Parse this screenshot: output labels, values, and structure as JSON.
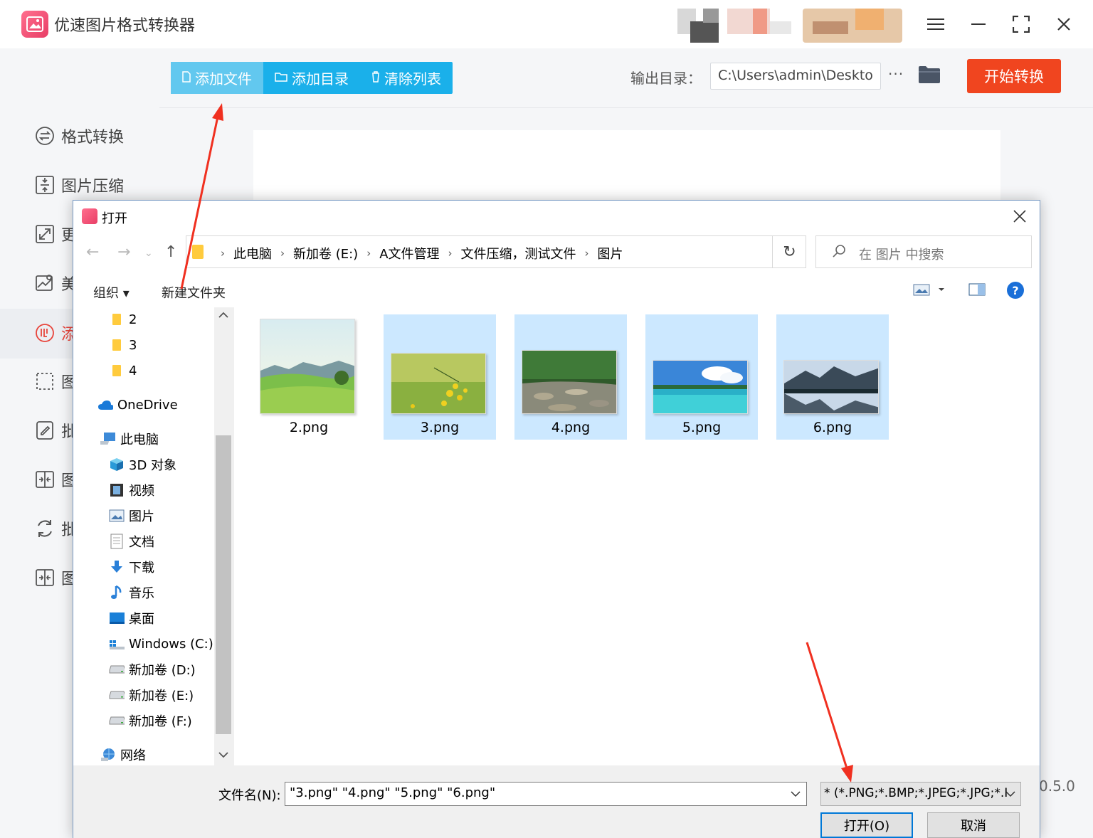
{
  "app": {
    "title": "优速图片格式转换器",
    "accent": "#1ab0ea",
    "start_color": "#f0451f"
  },
  "window_controls": {
    "menu": "menu-icon",
    "minimize": "minimize-icon",
    "maximize": "maximize-icon",
    "close": "close-icon"
  },
  "sidebar": {
    "items": [
      {
        "label": "格式转换",
        "icon": "swap-icon"
      },
      {
        "label": "图片压缩",
        "icon": "compress-icon"
      },
      {
        "label": "更",
        "icon": "resize-icon"
      },
      {
        "label": "美",
        "icon": "beautify-icon"
      },
      {
        "label": "添",
        "icon": "watermark-icon",
        "active": true
      },
      {
        "label": "图",
        "icon": "crop-icon"
      },
      {
        "label": "批",
        "icon": "edit-icon"
      },
      {
        "label": "图",
        "icon": "merge-icon"
      },
      {
        "label": "批",
        "icon": "rotate-icon"
      },
      {
        "label": "图",
        "icon": "split-icon"
      }
    ]
  },
  "toolbar": {
    "add_file": "添加文件",
    "add_dir": "添加目录",
    "clear_list": "清除列表",
    "output_label": "输出目录：",
    "output_path": "C:\\Users\\admin\\Deskto",
    "more": "···",
    "start": "开始转换"
  },
  "version": "0.5.0",
  "dialog": {
    "title": "打开",
    "breadcrumb": [
      "此电脑",
      "新加卷 (E:)",
      "A文件管理",
      "文件压缩，测试文件",
      "图片"
    ],
    "search_placeholder": "在 图片 中搜索",
    "organize": "组织 ▾",
    "new_folder": "新建文件夹",
    "help": "?",
    "nav": [
      {
        "label": "2",
        "icon": "folder-icon"
      },
      {
        "label": "3",
        "icon": "folder-icon"
      },
      {
        "label": "4",
        "icon": "folder-icon"
      },
      {
        "label": "OneDrive",
        "icon": "cloud-icon"
      },
      {
        "label": "此电脑",
        "icon": "computer-icon"
      },
      {
        "label": "3D 对象",
        "icon": "cube-icon"
      },
      {
        "label": "视频",
        "icon": "video-icon"
      },
      {
        "label": "图片",
        "icon": "pictures-icon"
      },
      {
        "label": "文档",
        "icon": "document-icon"
      },
      {
        "label": "下载",
        "icon": "download-icon"
      },
      {
        "label": "音乐",
        "icon": "music-icon"
      },
      {
        "label": "桌面",
        "icon": "desktop-icon"
      },
      {
        "label": "Windows (C:)",
        "icon": "drive-icon"
      },
      {
        "label": "新加卷 (D:)",
        "icon": "drive-icon"
      },
      {
        "label": "新加卷 (E:)",
        "icon": "drive-icon",
        "selected": true
      },
      {
        "label": "新加卷 (F:)",
        "icon": "drive-icon"
      },
      {
        "label": "网络",
        "icon": "network-icon"
      }
    ],
    "files": [
      {
        "name": "2.png",
        "selected": false
      },
      {
        "name": "3.png",
        "selected": true
      },
      {
        "name": "4.png",
        "selected": true
      },
      {
        "name": "5.png",
        "selected": true
      },
      {
        "name": "6.png",
        "selected": true
      }
    ],
    "filename_label": "文件名(N):",
    "filename_value": "\"3.png\" \"4.png\" \"5.png\" \"6.png\"",
    "filetype": "* (*.PNG;*.BMP;*.JPEG;*.JPG;*.I",
    "open": "打开(O)",
    "cancel": "取消"
  }
}
